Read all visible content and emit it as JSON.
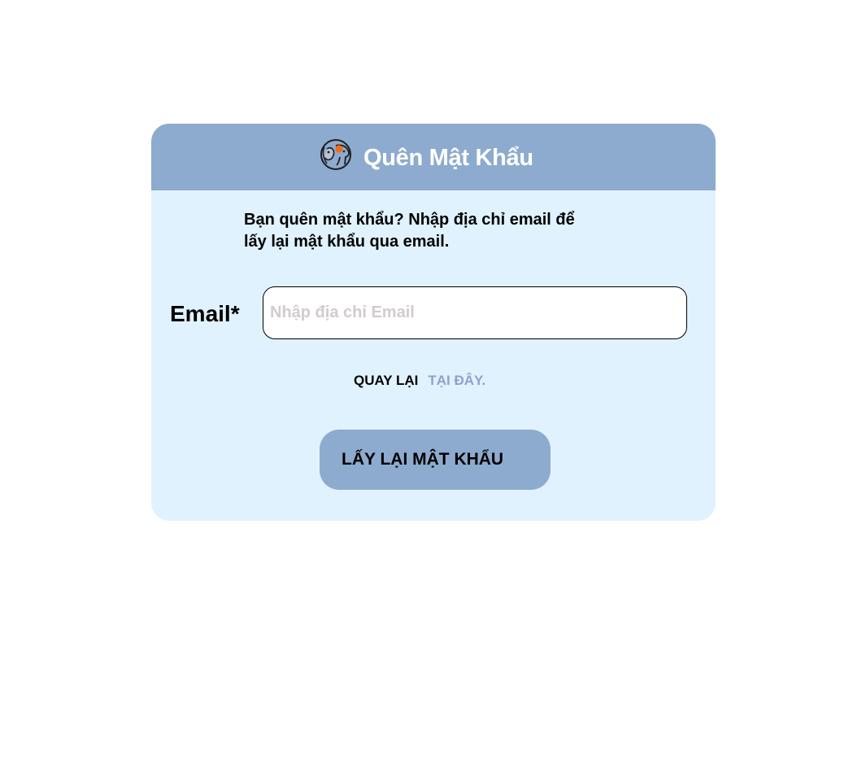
{
  "header": {
    "title": "Quên Mật Khẩu",
    "logo_icon": "pet-logo-icon"
  },
  "form": {
    "description": "Bạn quên mật khẩu? Nhập địa chỉ email để lấy lại mật khẩu qua email.",
    "email_label": "Email*",
    "email_placeholder": "Nhập địa chỉ Email",
    "email_value": ""
  },
  "back": {
    "text": "QUAY LẠI",
    "link": "TẠI ĐÂY."
  },
  "submit": {
    "label": "LẤY LẠI MẬT KHẨU"
  },
  "colors": {
    "card_background": "#e0f2fe",
    "header_background": "#8dabce",
    "link_color": "#8fa1cd",
    "button_background": "#8dabce",
    "logo_accent": "#f26a1b"
  }
}
